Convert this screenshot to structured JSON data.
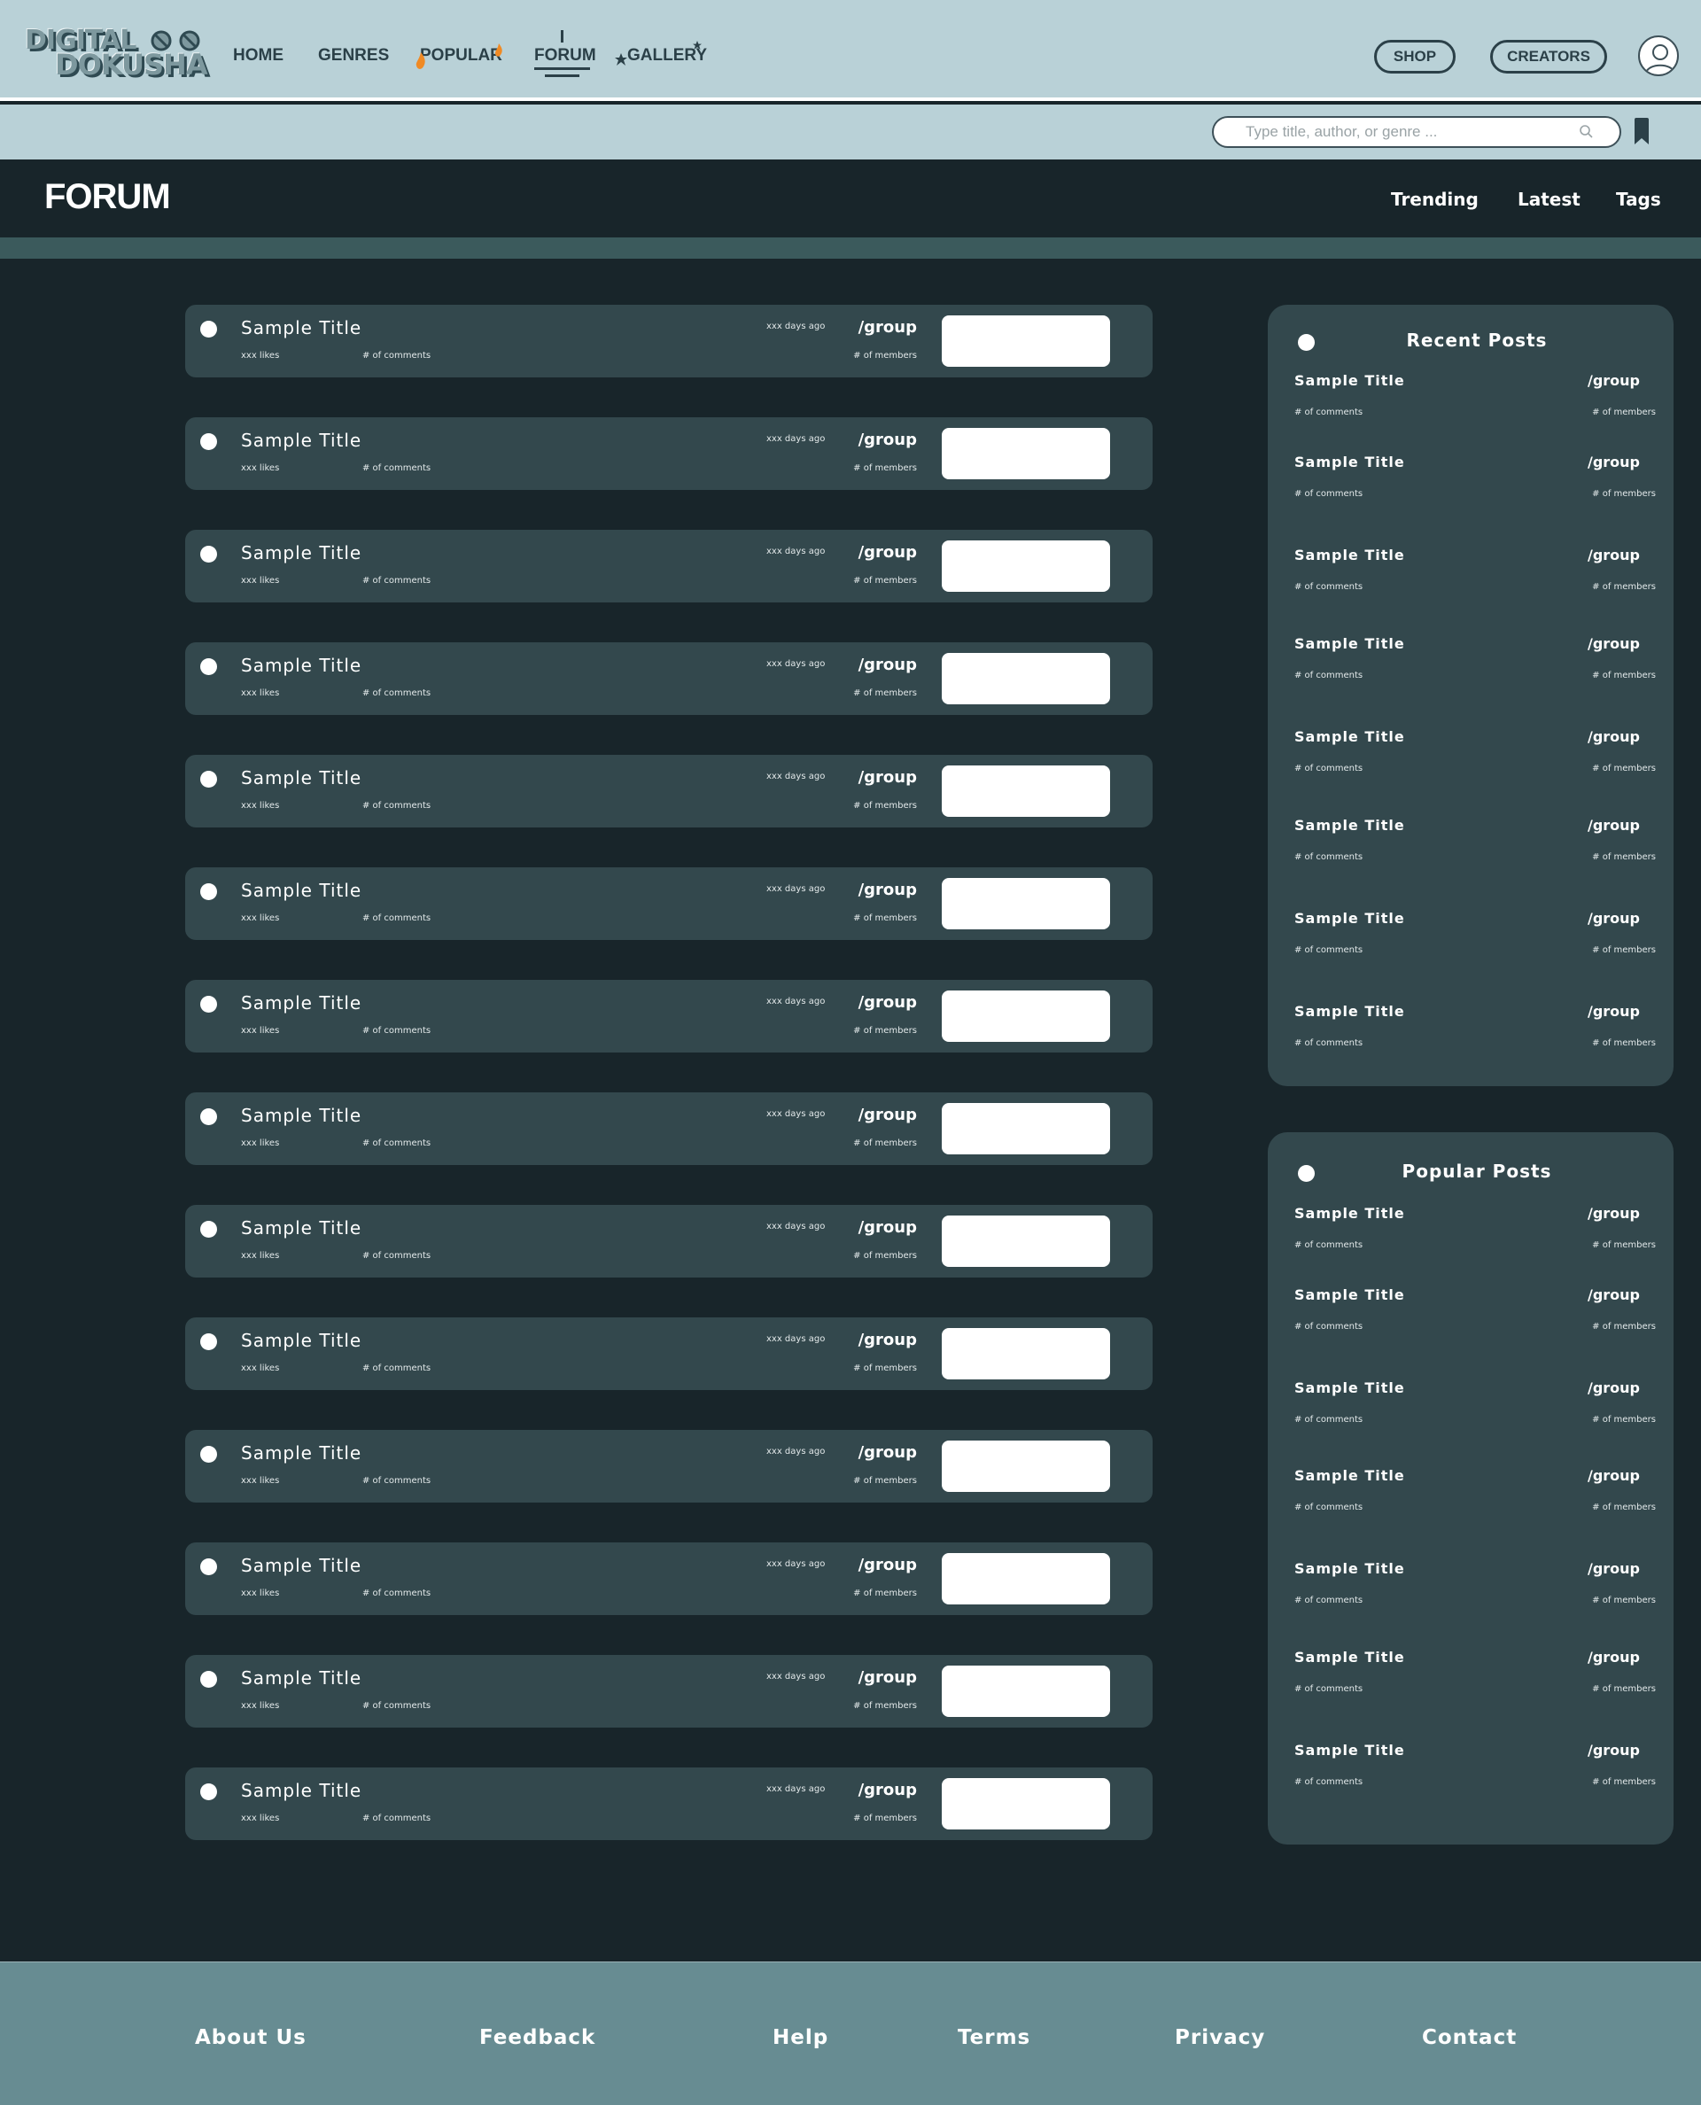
{
  "brand": {
    "line1": "DIGITAL",
    "line2": "DOKUSHA"
  },
  "nav": [
    {
      "label": "HOME"
    },
    {
      "label": "GENRES"
    },
    {
      "label": "POPULAR"
    },
    {
      "label": "FORUM"
    },
    {
      "label": "GALLERY"
    }
  ],
  "nav_active": "FORUM",
  "header_buttons": {
    "shop": "SHOP",
    "creators": "CREATORS"
  },
  "search": {
    "placeholder": "Type title, author, or genre ...",
    "value": ""
  },
  "page": {
    "title": "FORUM"
  },
  "subnav": {
    "trending": "Trending",
    "latest": "Latest",
    "tags": "Tags"
  },
  "posts": [
    {
      "title": "Sample Title",
      "likes": "xxx likes",
      "comments": "# of comments",
      "time": "xxx days ago",
      "group": "/group",
      "members": "# of members"
    },
    {
      "title": "Sample Title",
      "likes": "xxx likes",
      "comments": "# of comments",
      "time": "xxx days ago",
      "group": "/group",
      "members": "# of members"
    },
    {
      "title": "Sample Title",
      "likes": "xxx likes",
      "comments": "# of comments",
      "time": "xxx days ago",
      "group": "/group",
      "members": "# of members"
    },
    {
      "title": "Sample Title",
      "likes": "xxx likes",
      "comments": "# of comments",
      "time": "xxx days ago",
      "group": "/group",
      "members": "# of members"
    },
    {
      "title": "Sample Title",
      "likes": "xxx likes",
      "comments": "# of comments",
      "time": "xxx days ago",
      "group": "/group",
      "members": "# of members"
    },
    {
      "title": "Sample Title",
      "likes": "xxx likes",
      "comments": "# of comments",
      "time": "xxx days ago",
      "group": "/group",
      "members": "# of members"
    },
    {
      "title": "Sample Title",
      "likes": "xxx likes",
      "comments": "# of comments",
      "time": "xxx days ago",
      "group": "/group",
      "members": "# of members"
    },
    {
      "title": "Sample Title",
      "likes": "xxx likes",
      "comments": "# of comments",
      "time": "xxx days ago",
      "group": "/group",
      "members": "# of members"
    },
    {
      "title": "Sample Title",
      "likes": "xxx likes",
      "comments": "# of comments",
      "time": "xxx days ago",
      "group": "/group",
      "members": "# of members"
    },
    {
      "title": "Sample Title",
      "likes": "xxx likes",
      "comments": "# of comments",
      "time": "xxx days ago",
      "group": "/group",
      "members": "# of members"
    },
    {
      "title": "Sample Title",
      "likes": "xxx likes",
      "comments": "# of comments",
      "time": "xxx days ago",
      "group": "/group",
      "members": "# of members"
    },
    {
      "title": "Sample Title",
      "likes": "xxx likes",
      "comments": "# of comments",
      "time": "xxx days ago",
      "group": "/group",
      "members": "# of members"
    },
    {
      "title": "Sample Title",
      "likes": "xxx likes",
      "comments": "# of comments",
      "time": "xxx days ago",
      "group": "/group",
      "members": "# of members"
    },
    {
      "title": "Sample Title",
      "likes": "xxx likes",
      "comments": "# of comments",
      "time": "xxx days ago",
      "group": "/group",
      "members": "# of members"
    }
  ],
  "recent": {
    "title": "Recent Posts",
    "items": [
      {
        "title": "Sample Title",
        "group": "/group",
        "comments": "# of comments",
        "members": "# of members"
      },
      {
        "title": "Sample Title",
        "group": "/group",
        "comments": "# of comments",
        "members": "# of members"
      },
      {
        "title": "Sample Title",
        "group": "/group",
        "comments": "# of comments",
        "members": "# of members"
      },
      {
        "title": "Sample Title",
        "group": "/group",
        "comments": "# of comments",
        "members": "# of members"
      },
      {
        "title": "Sample Title",
        "group": "/group",
        "comments": "# of comments",
        "members": "# of members"
      },
      {
        "title": "Sample Title",
        "group": "/group",
        "comments": "# of comments",
        "members": "# of members"
      },
      {
        "title": "Sample Title",
        "group": "/group",
        "comments": "# of comments",
        "members": "# of members"
      },
      {
        "title": "Sample Title",
        "group": "/group",
        "comments": "# of comments",
        "members": "# of members"
      }
    ]
  },
  "popular": {
    "title": "Popular Posts",
    "items": [
      {
        "title": "Sample Title",
        "group": "/group",
        "comments": "# of comments",
        "members": "# of members"
      },
      {
        "title": "Sample Title",
        "group": "/group",
        "comments": "# of comments",
        "members": "# of members"
      },
      {
        "title": "Sample Title",
        "group": "/group",
        "comments": "# of comments",
        "members": "# of members"
      },
      {
        "title": "Sample Title",
        "group": "/group",
        "comments": "# of comments",
        "members": "# of members"
      },
      {
        "title": "Sample Title",
        "group": "/group",
        "comments": "# of comments",
        "members": "# of members"
      },
      {
        "title": "Sample Title",
        "group": "/group",
        "comments": "# of comments",
        "members": "# of members"
      },
      {
        "title": "Sample Title",
        "group": "/group",
        "comments": "# of comments",
        "members": "# of members"
      }
    ]
  },
  "footer": {
    "links": [
      "About Us",
      "Feedback",
      "Help",
      "Terms",
      "Privacy",
      "Contact"
    ]
  },
  "colors": {
    "header_bg": "#b9d1d7",
    "page_bg": "#18252a",
    "card_bg": "#33484d",
    "accent_strip": "#3b5a5c",
    "footer_bg": "#678c92",
    "nav_text": "#2b4048",
    "flame": "#f08a24"
  },
  "icons": {
    "search": "search-icon",
    "bookmark": "bookmark-icon",
    "avatar": "user-avatar-icon",
    "popular": "flame-icon",
    "gallery": "star-icon"
  }
}
